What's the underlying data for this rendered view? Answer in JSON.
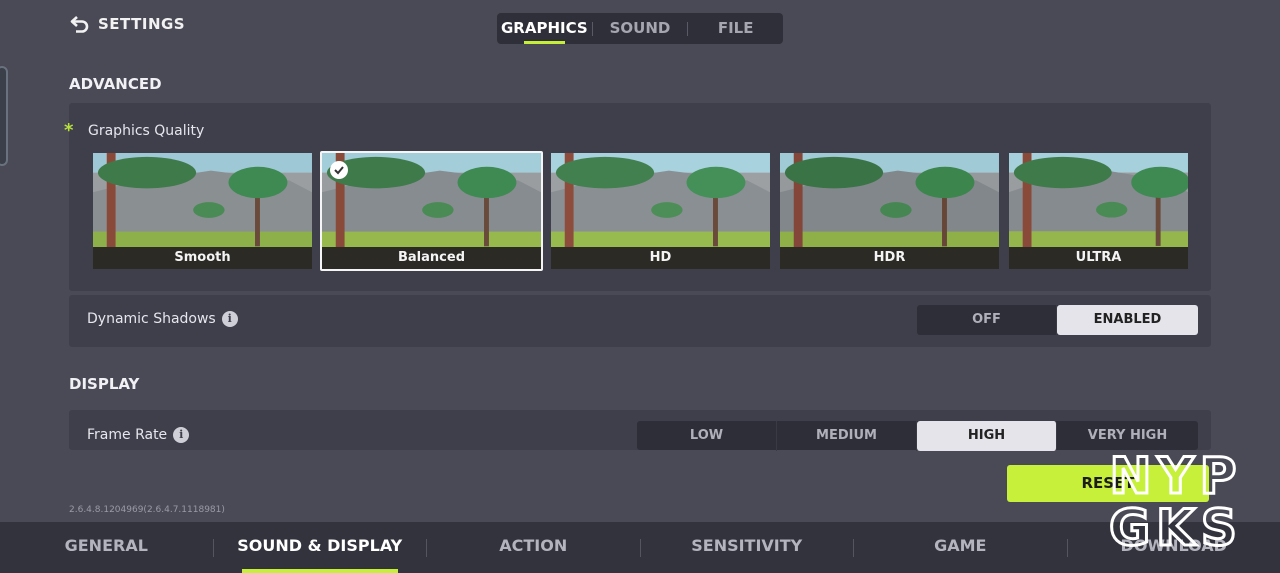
{
  "header": {
    "title": "SETTINGS"
  },
  "top_tabs": [
    {
      "label": "GRAPHICS",
      "active": true
    },
    {
      "label": "SOUND",
      "active": false
    },
    {
      "label": "FILE",
      "active": false
    }
  ],
  "advanced": {
    "title": "ADVANCED",
    "graphics_quality": {
      "label": "Graphics Quality",
      "star": "*",
      "presets": [
        {
          "label": "Smooth",
          "selected": false
        },
        {
          "label": "Balanced",
          "selected": true
        },
        {
          "label": "HD",
          "selected": false
        },
        {
          "label": "HDR",
          "selected": false
        },
        {
          "label": "ULTRA",
          "selected": false
        }
      ]
    },
    "dynamic_shadows": {
      "label": "Dynamic Shadows",
      "options": [
        "OFF",
        "ENABLED"
      ],
      "selected": "ENABLED"
    }
  },
  "display": {
    "title": "DISPLAY",
    "frame_rate": {
      "label": "Frame Rate",
      "options": [
        "LOW",
        "MEDIUM",
        "HIGH",
        "VERY HIGH"
      ],
      "selected": "HIGH"
    }
  },
  "version": "2.6.4.8.1204969(2.6.4.7.1118981)",
  "reset_label": "RESET",
  "bottom_nav": [
    {
      "label": "GENERAL",
      "active": false
    },
    {
      "label": "SOUND & DISPLAY",
      "active": true
    },
    {
      "label": "ACTION",
      "active": false
    },
    {
      "label": "SENSITIVITY",
      "active": false
    },
    {
      "label": "GAME",
      "active": false
    },
    {
      "label": "DOWNLOAD",
      "active": false
    }
  ],
  "watermark": {
    "line1": "NYP",
    "line2": "GKS"
  },
  "colors": {
    "accent": "#c6ef3a",
    "background": "#4a4a56",
    "panel": "#3f3f4b"
  }
}
